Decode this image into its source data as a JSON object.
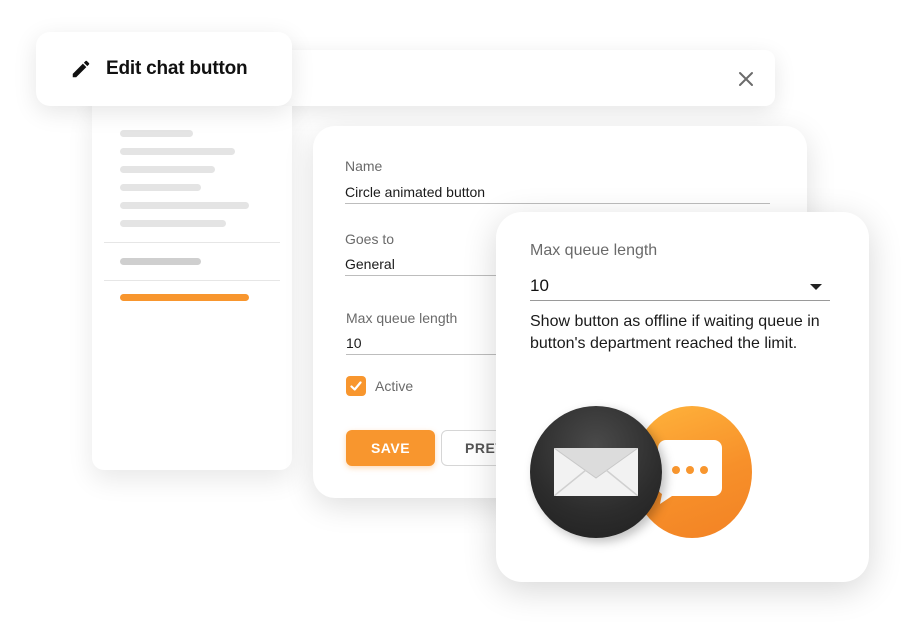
{
  "dialog": {
    "title": "Edit chat button",
    "icons": {
      "edit": "pencil-icon",
      "close": "close-icon"
    }
  },
  "form": {
    "name_label": "Name",
    "name_value": "Circle animated button",
    "goes_to_label": "Goes to",
    "goes_to_value": "General",
    "max_queue_label": "Max queue length",
    "max_queue_value": "10",
    "active_label": "Active",
    "active_checked": true,
    "save_label": "SAVE",
    "preview_label": "PREV"
  },
  "popup": {
    "label": "Max queue length",
    "value": "10",
    "description": "Show button as offline if waiting queue in button's department reached the limit."
  },
  "colors": {
    "accent": "#f8962e",
    "dark_button": "#2c2c2c"
  }
}
